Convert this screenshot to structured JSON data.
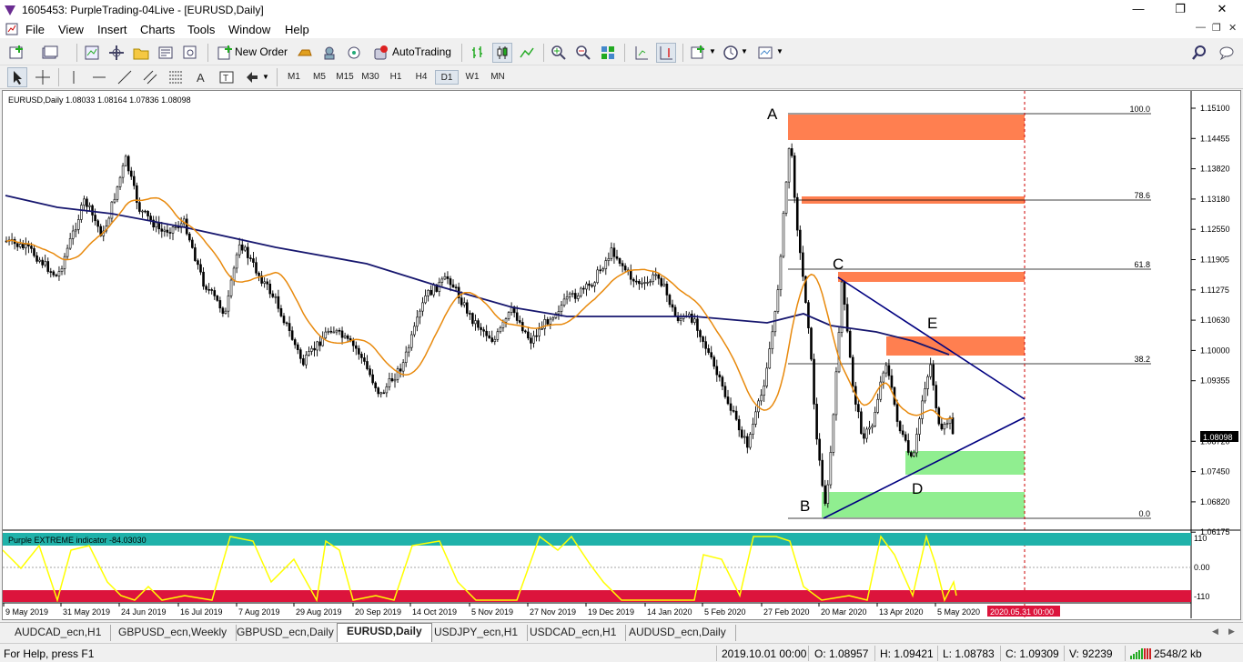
{
  "window": {
    "title": "1605453: PurpleTrading-04Live - [EURUSD,Daily]",
    "minimize": "—",
    "restore": "❐",
    "close": "✕"
  },
  "menu": [
    "File",
    "View",
    "Insert",
    "Charts",
    "Tools",
    "Window",
    "Help"
  ],
  "toolbar": {
    "new_order": "New Order",
    "auto_trading": "AutoTrading"
  },
  "timeframes": [
    "M1",
    "M5",
    "M15",
    "M30",
    "H1",
    "H4",
    "D1",
    "W1",
    "MN"
  ],
  "active_timeframe": "D1",
  "chart": {
    "info": "EURUSD,Daily  1.08033 1.08164 1.07836 1.08098",
    "current_price": "1.08098",
    "price_ticks": [
      "1.15100",
      "1.14455",
      "1.13820",
      "1.13180",
      "1.12550",
      "1.11905",
      "1.11275",
      "1.10630",
      "1.10000",
      "1.09355",
      "1.08720",
      "1.07450",
      "1.06820",
      "1.06175"
    ],
    "date_ticks": [
      "9 May 2019",
      "31 May 2019",
      "24 Jun 2019",
      "16 Jul 2019",
      "7 Aug 2019",
      "29 Aug 2019",
      "20 Sep 2019",
      "14 Oct 2019",
      "5 Nov 2019",
      "27 Nov 2019",
      "19 Dec 2019",
      "14 Jan 2020",
      "5 Feb 2020",
      "27 Feb 2020",
      "20 Mar 2020",
      "13 Apr 2020",
      "5 May 2020"
    ],
    "date_highlight": "2020.05.31 00:00",
    "fib_levels": [
      "100.0",
      "78.6",
      "61.8",
      "38.2",
      "0.0"
    ],
    "wave_labels": [
      "A",
      "B",
      "C",
      "D",
      "E"
    ],
    "indicator_label": "Purple EXTREME indicator -84.03030",
    "indicator_ticks": [
      "110",
      "0.00",
      "-110"
    ],
    "colors": {
      "ma_fast": "#e8890c",
      "ma_slow": "#16166e",
      "supply_zone": "#ff7f50",
      "demand_zone": "#90ee90",
      "indicator_line": "#ffff00",
      "indicator_top": "#20b2aa",
      "indicator_bottom": "#dc143c",
      "trendline": "#000080"
    }
  },
  "tabs": [
    "AUDCAD_ecn,H1",
    "GBPUSD_ecn,Weekly",
    "GBPUSD_ecn,Daily",
    "EURUSD,Daily",
    "USDJPY_ecn,H1",
    "USDCAD_ecn,H1",
    "AUDUSD_ecn,Daily"
  ],
  "active_tab": "EURUSD,Daily",
  "status": {
    "help": "For Help, press F1",
    "datetime": "2019.10.01 00:00",
    "open": "O: 1.08957",
    "high": "H: 1.09421",
    "low": "L: 1.08783",
    "close": "C: 1.09309",
    "volume": "V: 92239",
    "traffic": "2548/2 kb"
  }
}
